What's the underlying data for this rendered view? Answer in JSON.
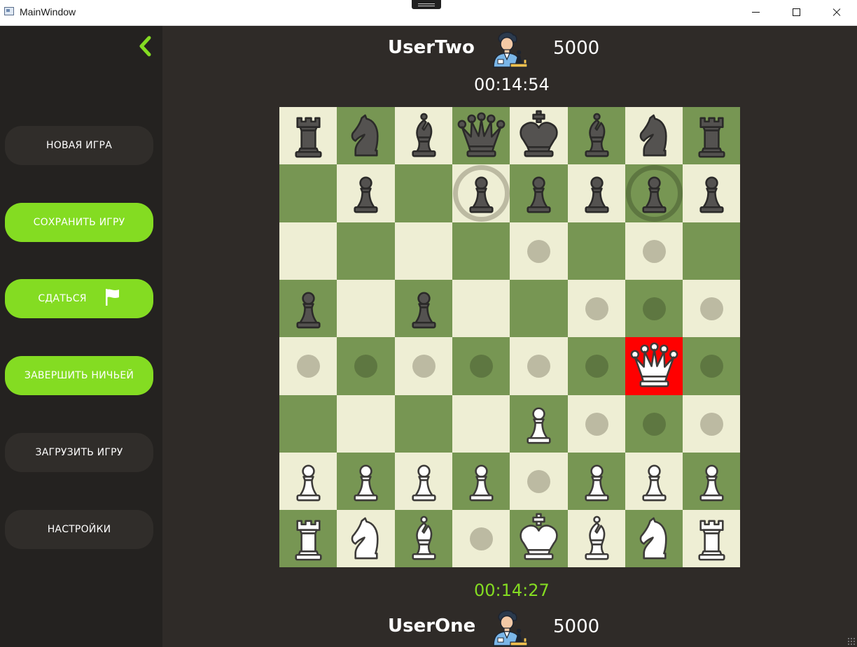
{
  "window": {
    "title": "MainWindow"
  },
  "sidebar": {
    "buttons": [
      {
        "label": "НОВАЯ ИГРА",
        "style": "dark"
      },
      {
        "label": "СОХРАНИТЬ ИГРУ",
        "style": "green"
      },
      {
        "label": "СДАТЬСЯ",
        "style": "green",
        "icon": "flag-icon"
      },
      {
        "label": "ЗАВЕРШИТЬ НИЧЬЕЙ",
        "style": "green"
      },
      {
        "label": "ЗАГРУЗИТЬ ИГРУ",
        "style": "dark"
      },
      {
        "label": "НАСТРОЙКИ",
        "style": "dark"
      }
    ]
  },
  "top_player": {
    "name": "UserTwo",
    "score": "5000",
    "timer": "00:14:54",
    "avatar": "chess-player-avatar-icon"
  },
  "bottom_player": {
    "name": "UserOne",
    "score": "5000",
    "timer": "00:14:27",
    "avatar": "chess-player-avatar-icon"
  },
  "colors": {
    "accent": "#84dc22",
    "light_square": "#eeeed4",
    "dark_square": "#779653",
    "highlight_square": "#ff0000",
    "sidebar": "#242220",
    "background": "#2f2b28"
  },
  "board": {
    "ranks": [
      [
        "bR",
        "bN",
        "bB",
        "bQ",
        "bK",
        "bB",
        "bN",
        "bR"
      ],
      [
        "",
        "bP",
        "",
        "bP",
        "bP",
        "bP",
        "bP",
        "bP"
      ],
      [
        "",
        "",
        "",
        "",
        "",
        "",
        "",
        ""
      ],
      [
        "bP",
        "",
        "bP",
        "",
        "",
        "",
        "",
        ""
      ],
      [
        "",
        "",
        "",
        "",
        "",
        "",
        "wQ",
        ""
      ],
      [
        "",
        "",
        "",
        "",
        "wP",
        "",
        "",
        ""
      ],
      [
        "wP",
        "wP",
        "wP",
        "wP",
        "",
        "wP",
        "wP",
        "wP"
      ],
      [
        "wR",
        "wN",
        "wB",
        "",
        "wK",
        "wB",
        "wN",
        "wR"
      ]
    ],
    "move_hints": [
      [
        2,
        4
      ],
      [
        2,
        6
      ],
      [
        3,
        5
      ],
      [
        3,
        6
      ],
      [
        3,
        7
      ],
      [
        4,
        0
      ],
      [
        4,
        1
      ],
      [
        4,
        2
      ],
      [
        4,
        3
      ],
      [
        4,
        4
      ],
      [
        4,
        5
      ],
      [
        4,
        7
      ],
      [
        5,
        5
      ],
      [
        5,
        6
      ],
      [
        5,
        7
      ],
      [
        6,
        4
      ],
      [
        7,
        3
      ]
    ],
    "capture_hints": [
      [
        1,
        3
      ],
      [
        1,
        6
      ]
    ],
    "highlight": [
      4,
      6
    ]
  }
}
